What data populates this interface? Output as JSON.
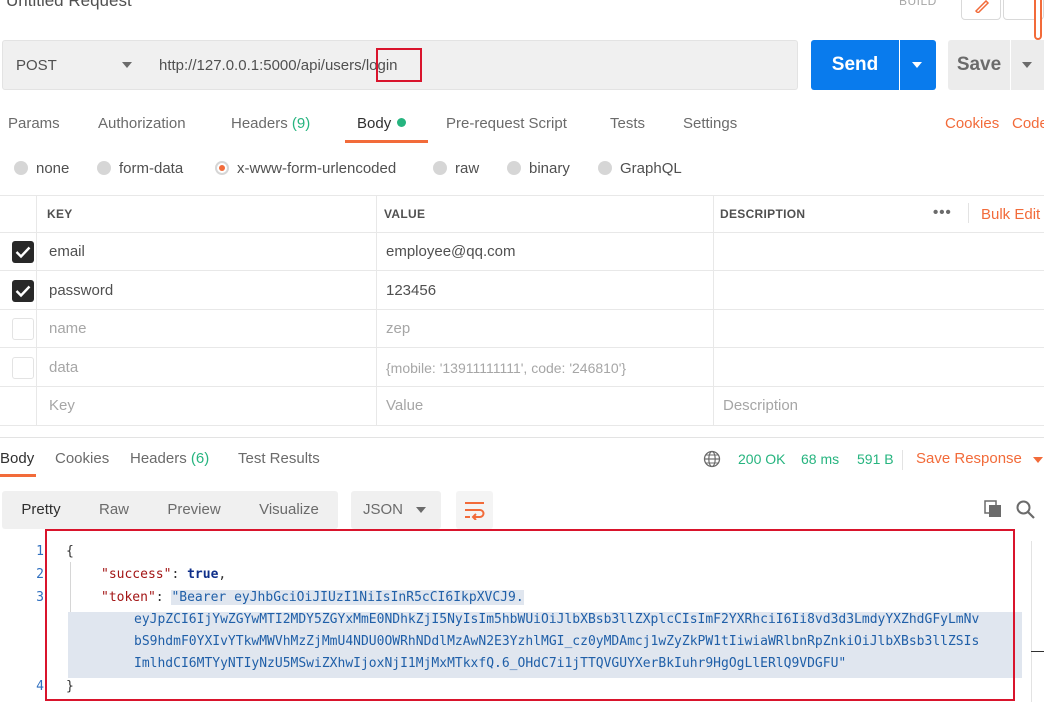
{
  "header": {
    "title": "Untitled Request",
    "build_label": "BUILD"
  },
  "request": {
    "method": "POST",
    "url": "http://127.0.0.1:5000/api/users/login",
    "send_label": "Send",
    "save_label": "Save"
  },
  "request_tabs": {
    "params": "Params",
    "authorization": "Authorization",
    "headers": "Headers",
    "headers_count": "(9)",
    "body": "Body",
    "pre_request": "Pre-request Script",
    "tests": "Tests",
    "settings": "Settings",
    "cookies": "Cookies",
    "code": "Code"
  },
  "body_types": {
    "none": "none",
    "form_data": "form-data",
    "urlencoded": "x-www-form-urlencoded",
    "raw": "raw",
    "binary": "binary",
    "graphql": "GraphQL",
    "selected": "x-www-form-urlencoded"
  },
  "params_table": {
    "col_key": "KEY",
    "col_value": "VALUE",
    "col_description": "DESCRIPTION",
    "more_label": "•••",
    "bulk_edit": "Bulk Edit",
    "rows": [
      {
        "checked": true,
        "key": "email",
        "value": "employee@qq.com"
      },
      {
        "checked": true,
        "key": "password",
        "value": "123456"
      },
      {
        "checked": false,
        "key": "name",
        "value": "zep"
      },
      {
        "checked": false,
        "key": "data",
        "value": "{mobile: '13911111111', code: '246810'}"
      }
    ],
    "placeholder_key": "Key",
    "placeholder_value": "Value",
    "placeholder_description": "Description"
  },
  "response_tabs": {
    "body": "Body",
    "cookies": "Cookies",
    "headers": "Headers",
    "headers_count": "(6)",
    "test_results": "Test Results"
  },
  "response_status": {
    "status": "200 OK",
    "time": "68 ms",
    "size": "591 B",
    "save_response": "Save Response"
  },
  "view_modes": {
    "pretty": "Pretty",
    "raw": "Raw",
    "preview": "Preview",
    "visualize": "Visualize",
    "format": "JSON"
  },
  "response_body": {
    "line_numbers": [
      "1",
      "2",
      "3",
      "4"
    ],
    "open_brace": "{",
    "close_brace": "}",
    "success_key": "\"success\"",
    "success_value": "true",
    "token_key": "\"token\"",
    "token_line_1": "\"Bearer eyJhbGciOiJIUzI1NiIsInR5cCI6IkpXVCJ9.",
    "token_line_2": "eyJpZCI6IjYwZGYwMTI2MDY5ZGYxMmE0NDhkZjI5NyIsIm5hbWUiOiJlbXBsb3llZXplcCIsImF2YXRhciI6Ii8vd3d3LmdyYXZhdGFyLmNv",
    "token_line_3": "bS9hdmF0YXIvYTkwMWVhMzZjMmU4NDU0OWRhNDdlMzAwN2E3YzhlMGI_cz0yMDAmcj1wZyZkPW1tIiwiaWRlbnRpZnkiOiJlbXBsb3llZSIs",
    "token_line_4": "ImlhdCI6MTYyNTIyNzU5MSwiZXhwIjoxNjI1MjMxMTkxfQ.6_OHdC7i1jTTQVGUYXerBkIuhr9HgOgLlERlQ9VDGFU\""
  },
  "colors": {
    "accent": "#f26b3a",
    "send_blue": "#097bed",
    "success_green": "#26b47f",
    "annotation_red": "#d9142c"
  }
}
